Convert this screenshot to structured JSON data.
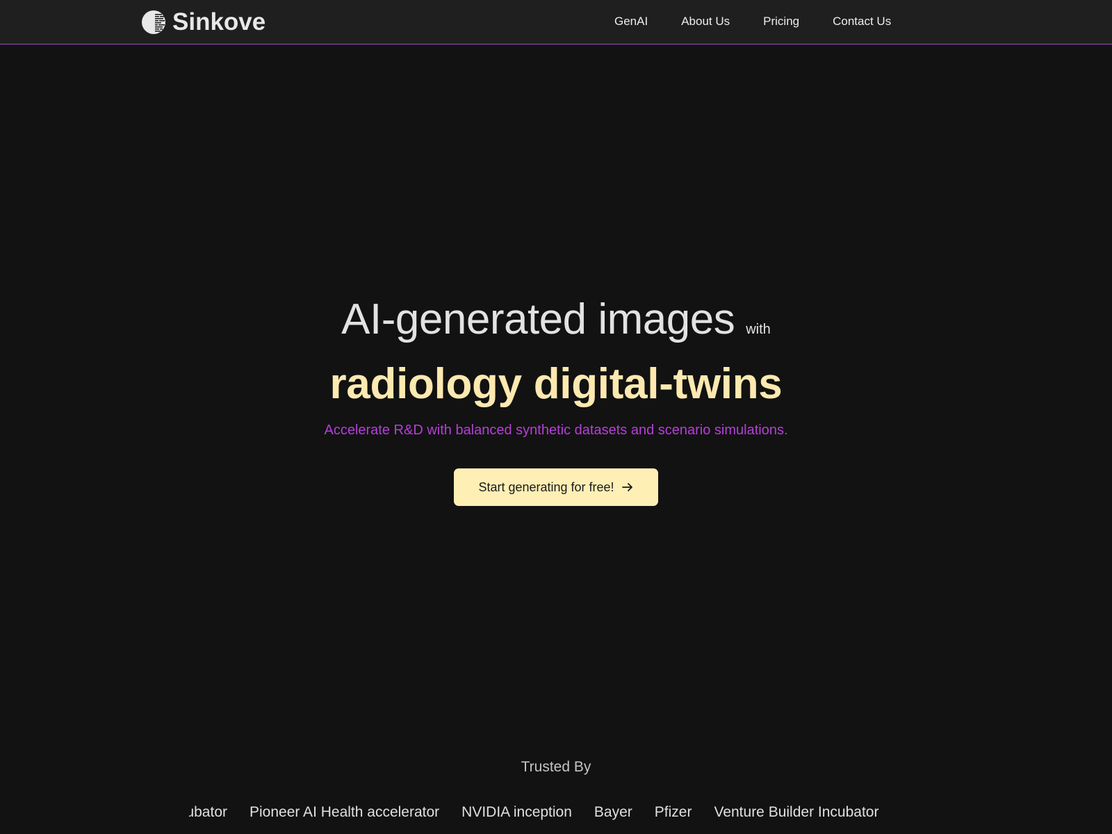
{
  "header": {
    "brand": "Sinkove",
    "logo_icon": "half-circle-scan-icon",
    "nav": [
      {
        "label": "GenAI"
      },
      {
        "label": "About Us"
      },
      {
        "label": "Pricing"
      },
      {
        "label": "Contact Us"
      }
    ],
    "accent_border_color": "#9b4fc0"
  },
  "hero": {
    "title_line1": "AI-generated images",
    "title_with": "with",
    "title_line2": "radiology digital-twins",
    "subtitle": "Accelerate R&D with balanced synthetic datasets and scenario simulations.",
    "cta_label": "Start generating for free!",
    "cta_icon": "arrow-right-icon",
    "colors": {
      "title_line2": "#fde9b0",
      "subtitle": "#b63fd8",
      "cta_bg": "#feefb5"
    }
  },
  "trusted": {
    "heading": "Trusted By",
    "partners": [
      "Venture Builder Incubator",
      "Pioneer AI Health accelerator",
      "NVIDIA inception",
      "Bayer",
      "Pfizer",
      "Venture Builder Incubator"
    ]
  }
}
